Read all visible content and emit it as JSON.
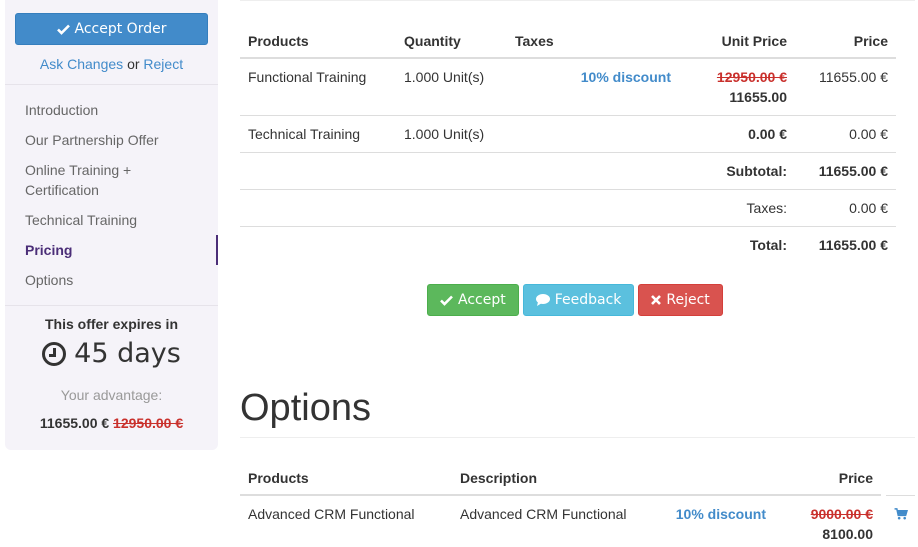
{
  "sidebar": {
    "accept_order_label": "Accept Order",
    "ask_changes_label": "Ask Changes",
    "or_text": "or",
    "reject_label": "Reject",
    "nav": [
      {
        "label": "Introduction",
        "active": false
      },
      {
        "label": "Our Partnership Offer",
        "active": false
      },
      {
        "label": "Online Training + Certification",
        "active": false
      },
      {
        "label": "Technical Training",
        "active": false
      },
      {
        "label": "Pricing",
        "active": true
      },
      {
        "label": "Options",
        "active": false
      }
    ],
    "expires_title": "This offer expires in",
    "expires_value": "45 days",
    "advantage_label": "Your advantage:",
    "advantage_price": "11655.00 €",
    "advantage_old_price": "12950.00 €"
  },
  "pricing": {
    "headers": {
      "products": "Products",
      "quantity": "Quantity",
      "taxes": "Taxes",
      "unit_price": "Unit Price",
      "price": "Price"
    },
    "rows": [
      {
        "product": "Functional Training",
        "quantity": "1.000 Unit(s)",
        "taxes": "",
        "discount": "10% discount",
        "old_unit_price": "12950.00 €",
        "unit_price": "11655.00",
        "price": "11655.00 €"
      },
      {
        "product": "Technical Training",
        "quantity": "1.000 Unit(s)",
        "taxes": "",
        "discount": "",
        "old_unit_price": "",
        "unit_price": "0.00 €",
        "price": "0.00 €"
      }
    ],
    "subtotal_label": "Subtotal:",
    "subtotal": "11655.00 €",
    "taxes_label": "Taxes:",
    "taxes": "0.00 €",
    "total_label": "Total:",
    "total": "11655.00 €"
  },
  "actions": {
    "accept": "Accept",
    "feedback": "Feedback",
    "reject": "Reject"
  },
  "options": {
    "title": "Options",
    "headers": {
      "products": "Products",
      "description": "Description",
      "price": "Price"
    },
    "rows": [
      {
        "product": "Advanced CRM Functional",
        "description": "Advanced CRM Functional",
        "discount": "10% discount",
        "old_price": "9000.00 €",
        "price": "8100.00"
      }
    ]
  },
  "colors": {
    "primary": "#428bca",
    "success": "#5cb85c",
    "info": "#5bc0de",
    "danger": "#d9534f",
    "active_nav": "#4b2e78",
    "strike": "#c9302c"
  }
}
